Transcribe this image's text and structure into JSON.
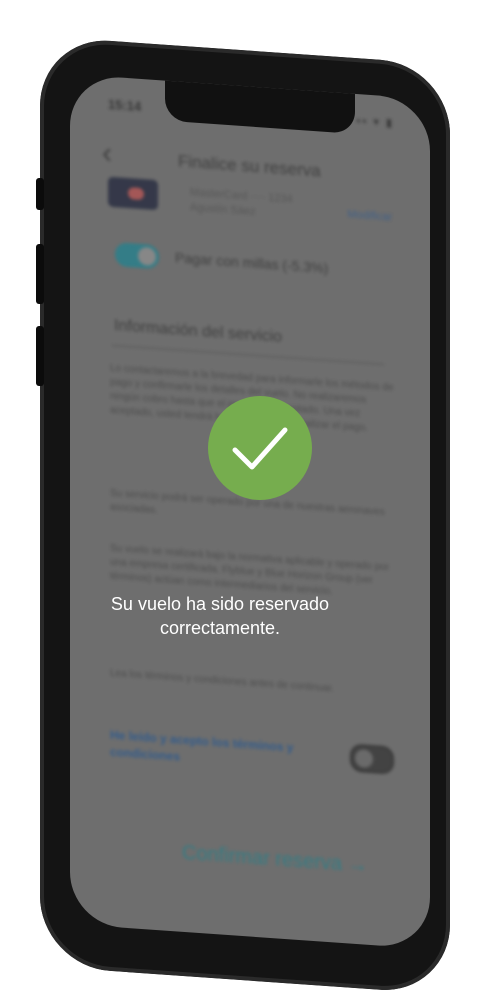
{
  "status_bar": {
    "time": "15:14",
    "icons": "▪▪ ▾ ▮"
  },
  "header": {
    "back_icon": "chevron-left-icon",
    "title": "Finalice su reserva"
  },
  "payment": {
    "card_line1": "MasterCard ···· 1234",
    "card_line2": "Agustín Sáez",
    "modify_label": "Modificar"
  },
  "miles_toggle": {
    "label": "Pagar con millas (-5.3%)",
    "state": "on"
  },
  "service_info": {
    "heading": "Información del servicio",
    "paragraph1": "Lo contactaremos a la brevedad para informarle los métodos de pago y confirmarle los detalles del vuelo. No realizaremos ningún cobro hasta que el precio sea aceptado. Una vez aceptado, usted tendrá hasta 5 días para finalizar el pago.",
    "paragraph2": "Su servicio podrá ser operado por una de nuestras aeronaves asociadas.",
    "paragraph3": "Su vuelo se realizará bajo la normativa aplicable y operado por una empresa certificada. Flyblue y Blue Horizon Group (ver términos) actúan como intermediarios del servicio.",
    "paragraph4": "Lea los términos y condiciones antes de continuar."
  },
  "terms": {
    "label": "He leído y acepto los términos y condiciones",
    "state": "off"
  },
  "confirm_button": {
    "label": "Confirmar reserva"
  },
  "overlay": {
    "message_line1": "Su vuelo ha sido reservado",
    "message_line2": "correctamente.",
    "icon": "checkmark-icon",
    "accent": "#76ad4e"
  }
}
